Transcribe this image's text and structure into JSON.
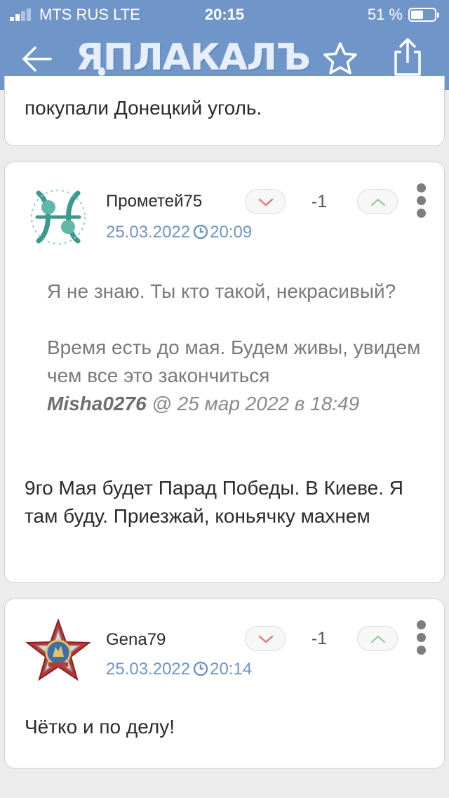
{
  "status_bar": {
    "carrier": "MTS RUS  LTE",
    "time": "20:15",
    "battery": "51 %",
    "battery_level": 0.51
  },
  "header": {
    "logo": "ЯПЛАКАЛЪ"
  },
  "previous_comment": {
    "text": "покупали  Донецкий уголь."
  },
  "comments": [
    {
      "username": "Прометей75",
      "date": "25.03.2022",
      "time": "20:09",
      "rating": "-1",
      "quote_paragraphs": [
        "Я не знаю. Ты кто такой, некрасивый?",
        "Время есть до мая. Будем живы, увидем чем все это закончиться"
      ],
      "quote_author": "Misha0276",
      "quote_at": "@ 25 мар 2022 в 18:49",
      "text": "9го Мая будет Парад Победы. В Киеве. Я там буду. Приезжай, коньячку махнем"
    },
    {
      "username": "Gena79",
      "date": "25.03.2022",
      "time": "20:14",
      "rating": "-1",
      "text": "Чётко и по делу!"
    }
  ],
  "colors": {
    "header_bg": "#6f95c9",
    "date_link": "#6f95c9",
    "downvote_chevron": "#e07b7b",
    "upvote_chevron": "#9ccf9c"
  }
}
